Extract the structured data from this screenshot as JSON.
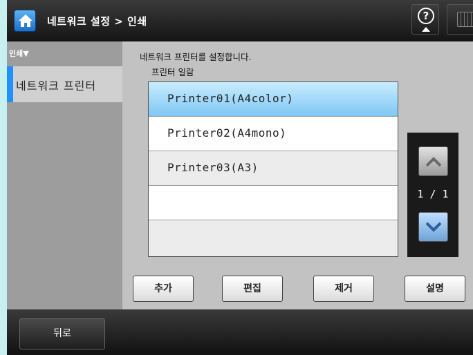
{
  "header": {
    "title": "네트워크 설정 > 인쇄",
    "home_icon": "home-icon",
    "help_icon": "help-icon",
    "keyboard_icon": "keyboard-icon"
  },
  "sidebar": {
    "section": "인쇄▼",
    "items": [
      {
        "label": "네트워크 프린터",
        "selected": true
      }
    ]
  },
  "main": {
    "description": "네트워크 프린터를 설정합니다.",
    "list_label": "프린터 일람",
    "rows": [
      {
        "label": "Printer01(A4color)",
        "selected": true
      },
      {
        "label": "Printer02(A4mono)",
        "selected": false
      },
      {
        "label": "Printer03(A3)",
        "selected": false
      },
      {
        "label": "",
        "selected": false
      },
      {
        "label": "",
        "selected": false
      }
    ],
    "pager": {
      "text": "1 / 1"
    },
    "buttons": {
      "add": "추가",
      "edit": "편집",
      "remove": "제거",
      "explain": "설명"
    }
  },
  "footer": {
    "back": "뒤로"
  },
  "colors": {
    "accent": "#1e90ff",
    "selected_row": "#7fc7f4",
    "header": "#1f1f1f"
  }
}
